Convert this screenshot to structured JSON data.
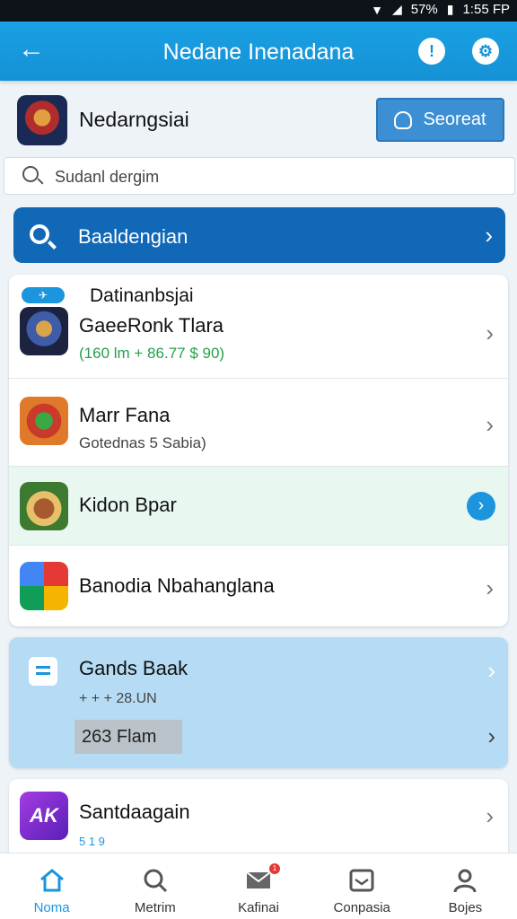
{
  "status_bar": {
    "battery": "57%",
    "time": "1:55 FP"
  },
  "app_bar": {
    "title": "Nedane Inenadana"
  },
  "profile": {
    "name": "Nedarngsiai",
    "button_label": "Seoreat"
  },
  "search": {
    "placeholder": "Sudanl dergim"
  },
  "banner": {
    "label": "Baaldengian"
  },
  "list_card": {
    "header": "Datinanbsjai",
    "items": [
      {
        "title": "GaeeRonk Tlara",
        "subtitle": "(160 lm + 86.77 $ 90)"
      },
      {
        "title": "Marr Fana",
        "subtitle": "Gotednas 5 Sabia)"
      },
      {
        "title": "Kidon Bpar"
      },
      {
        "title": "Banodia Nbahanglana"
      }
    ]
  },
  "wallet_card": {
    "title": "Gands Baak",
    "subtitle": "+ + + 28.UN",
    "chip": "263 Flam"
  },
  "bottom_card": {
    "icon_text": "AK",
    "title": "Santdaagain",
    "subtitle": "5 1 9"
  },
  "bottom_nav": [
    {
      "label": "Noma",
      "icon": "home-icon",
      "active": true
    },
    {
      "label": "Metrim",
      "icon": "search-icon"
    },
    {
      "label": "Kafinai",
      "icon": "mail-icon",
      "badge": "1"
    },
    {
      "label": "Conpasia",
      "icon": "inbox-icon"
    },
    {
      "label": "Bojes",
      "icon": "person-icon"
    }
  ],
  "colors": {
    "accent": "#1592d6",
    "banner": "#1168b6",
    "wallet_bg": "#b5dcf4",
    "highlight_row": "#e9f7f1",
    "badge": "#e53935"
  }
}
